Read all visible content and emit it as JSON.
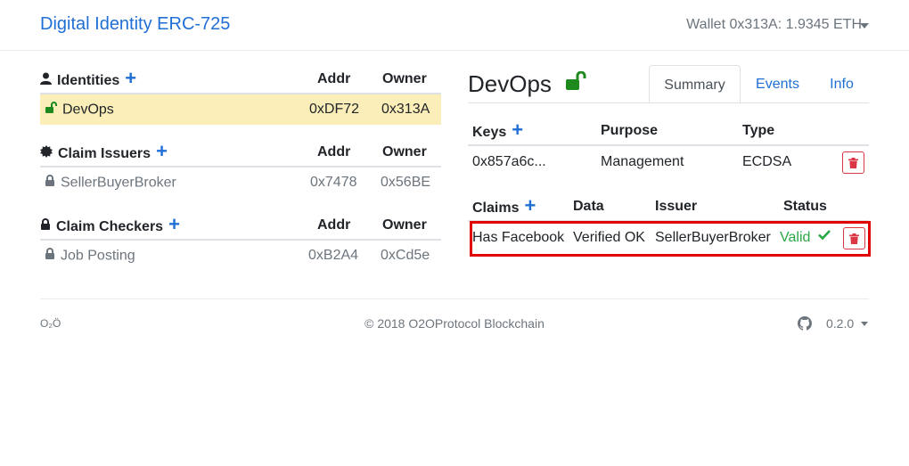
{
  "navbar": {
    "brand": "Digital Identity ERC-725",
    "wallet": "Wallet 0x313A: 1.9345 ETH"
  },
  "identities": {
    "heading": "Identities",
    "col_addr": "Addr",
    "col_owner": "Owner",
    "rows": [
      {
        "name": "DevOps",
        "addr": "0xDF72",
        "owner": "0x313A",
        "selected": true,
        "locked": false
      }
    ]
  },
  "claim_issuers": {
    "heading": "Claim Issuers",
    "col_addr": "Addr",
    "col_owner": "Owner",
    "rows": [
      {
        "name": "SellerBuyerBroker",
        "addr": "0x7478",
        "owner": "0x56BE",
        "locked": true
      }
    ]
  },
  "claim_checkers": {
    "heading": "Claim Checkers",
    "col_addr": "Addr",
    "col_owner": "Owner",
    "rows": [
      {
        "name": "Job Posting",
        "addr": "0xB2A4",
        "owner": "0xCd5e",
        "locked": true
      }
    ]
  },
  "detail": {
    "title": "DevOps",
    "tabs": [
      "Summary",
      "Events",
      "Info"
    ],
    "active_tab": "Summary",
    "keys": {
      "col_keys": "Keys",
      "col_purpose": "Purpose",
      "col_type": "Type",
      "rows": [
        {
          "key": "0x857a6c...",
          "purpose": "Management",
          "type": "ECDSA"
        }
      ]
    },
    "claims": {
      "col_claims": "Claims",
      "col_data": "Data",
      "col_issuer": "Issuer",
      "col_status": "Status",
      "rows": [
        {
          "claim": "Has Facebook",
          "data": "Verified OK",
          "issuer": "SellerBuyerBroker",
          "status": "Valid"
        }
      ]
    }
  },
  "footer": {
    "logo": "O₂Ö",
    "copyright": "© 2018  O2OProtocol Blockchain",
    "version": "0.2.0"
  },
  "colors": {
    "brand_blue": "#1f6fd6",
    "selected_row": "#fbeeb8",
    "unlock_green": "#1e8a1e",
    "valid_green": "#28a745",
    "danger_red": "#dc3545",
    "highlight_red": "#e00000"
  },
  "icons": {
    "identities": "user-icon",
    "claim_issuers": "certificate-icon",
    "claim_checkers": "lock-icon",
    "footer_github": "github-icon"
  }
}
